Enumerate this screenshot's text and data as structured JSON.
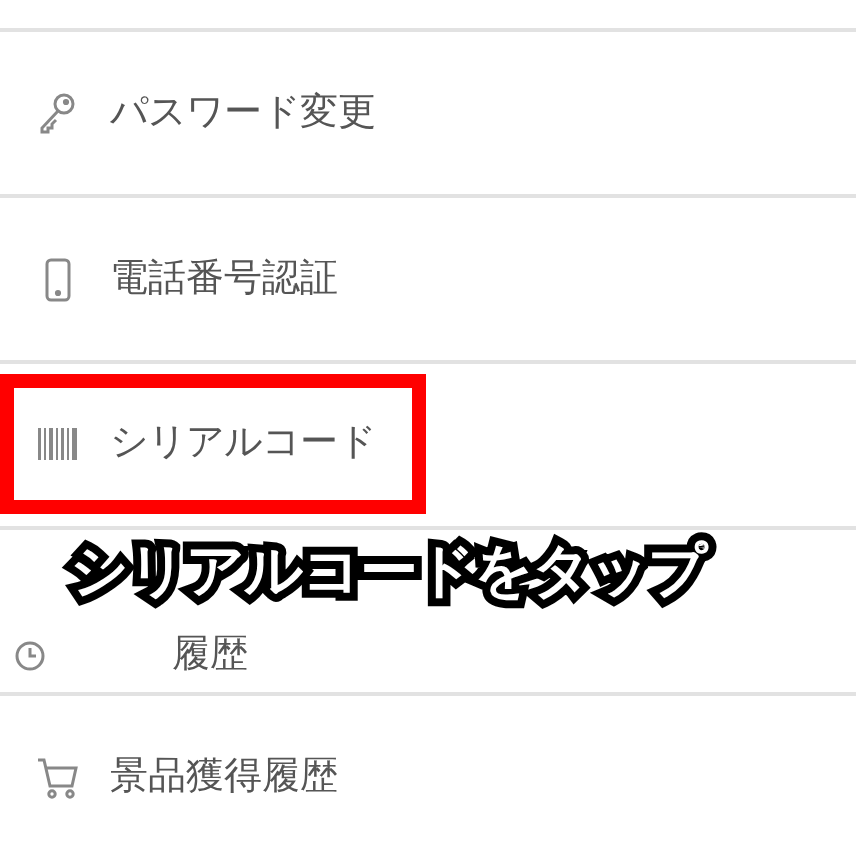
{
  "menu": {
    "items": [
      {
        "kind": "key",
        "label": "パスワード変更",
        "highlighted": false
      },
      {
        "kind": "phone",
        "label": "電話番号認証",
        "highlighted": false
      },
      {
        "kind": "barcode",
        "label": "シリアルコード",
        "highlighted": true
      },
      {
        "kind": "clock",
        "label": "履歴",
        "highlighted": false,
        "covered": true
      },
      {
        "kind": "cart",
        "label": "景品獲得履歴",
        "highlighted": false
      }
    ]
  },
  "caption": "シリアルコードをタップ"
}
